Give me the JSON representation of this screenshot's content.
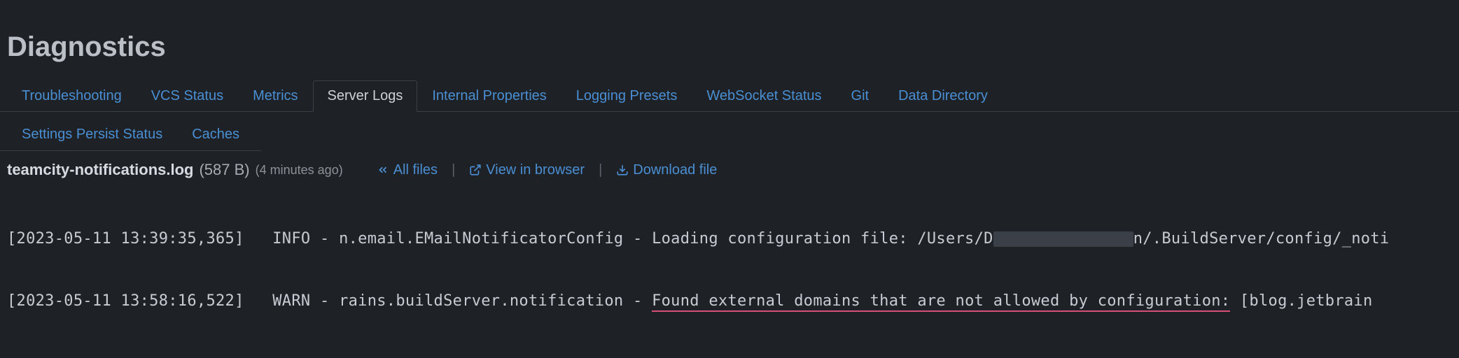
{
  "title": "Diagnostics",
  "tabs": [
    {
      "label": "Troubleshooting",
      "active": false
    },
    {
      "label": "VCS Status",
      "active": false
    },
    {
      "label": "Metrics",
      "active": false
    },
    {
      "label": "Server Logs",
      "active": true
    },
    {
      "label": "Internal Properties",
      "active": false
    },
    {
      "label": "Logging Presets",
      "active": false
    },
    {
      "label": "WebSocket Status",
      "active": false
    },
    {
      "label": "Git",
      "active": false
    },
    {
      "label": "Data Directory",
      "active": false
    }
  ],
  "secondary_tabs": [
    {
      "label": "Settings Persist Status"
    },
    {
      "label": "Caches"
    }
  ],
  "file": {
    "name": "teamcity-notifications.log",
    "size": "(587 B)",
    "age": "(4 minutes ago)"
  },
  "actions": {
    "all_files": "All files",
    "view_in_browser": "View in browser",
    "download": "Download file"
  },
  "log_lines": [
    {
      "prefix": "[2023-05-11 13:39:35,365]   INFO - n.email.EMailNotificatorConfig - Loading configuration file: /Users/D",
      "redacted": true,
      "suffix": "n/.BuildServer/config/_noti",
      "warn": false
    },
    {
      "prefix": "[2023-05-11 13:58:16,522]   WARN - rains.buildServer.notification - ",
      "warn_text": "Found external domains that are not allowed by configuration:",
      "suffix": " [blog.jetbrain",
      "warn": true
    }
  ]
}
